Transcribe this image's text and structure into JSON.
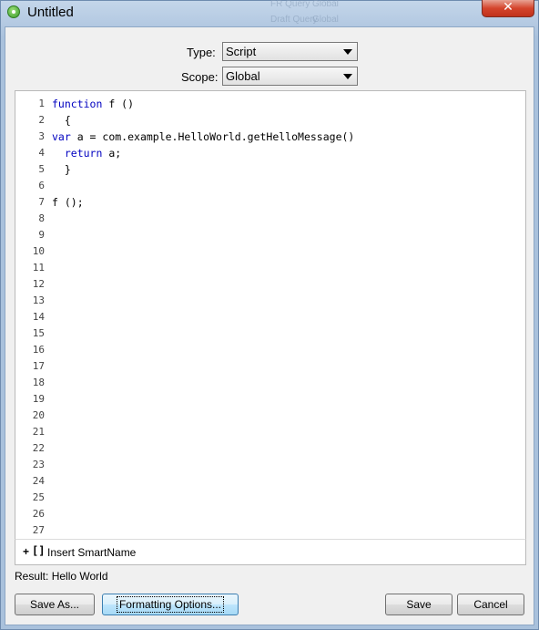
{
  "window": {
    "title": "Untitled",
    "close_glyph": "✕",
    "ghost_text": [
      "FR Query",
      "Global",
      "Draft Query",
      "Global"
    ]
  },
  "form": {
    "type_label": "Type:",
    "type_value": "Script",
    "scope_label": "Scope:",
    "scope_value": "Global"
  },
  "editor": {
    "line_numbers": [
      "1",
      "2",
      "3",
      "4",
      "5",
      "6",
      "7",
      "8",
      "9",
      "10",
      "11",
      "12",
      "13",
      "14",
      "15",
      "16",
      "17",
      "18",
      "19",
      "20",
      "21",
      "22",
      "23",
      "24",
      "25",
      "26",
      "27"
    ],
    "lines": [
      [
        {
          "t": "function",
          "k": true
        },
        {
          "t": " f ()",
          "k": false
        }
      ],
      [
        {
          "t": "  {",
          "k": false
        }
      ],
      [
        {
          "t": "var",
          "k": true
        },
        {
          "t": " a = com.example.HelloWorld.getHelloMessage()",
          "k": false
        }
      ],
      [
        {
          "t": "  ",
          "k": false
        },
        {
          "t": "return",
          "k": true
        },
        {
          "t": " a;",
          "k": false
        }
      ],
      [
        {
          "t": "  }",
          "k": false
        }
      ],
      [],
      [
        {
          "t": "f ();",
          "k": false
        }
      ]
    ]
  },
  "smartname": {
    "plus": "+",
    "brackets": "[]",
    "label": "Insert SmartName"
  },
  "result": {
    "label": "Result:",
    "value": "Hello World"
  },
  "buttons": {
    "save_as": "Save As...",
    "formatting": "Formatting Options...",
    "save": "Save",
    "cancel": "Cancel"
  },
  "colors": {
    "keyword": "#0000c0",
    "close": "#c0321b",
    "focus_button": "#bee6fd"
  },
  "icons": {
    "title": "app-gear-icon",
    "close": "close-icon",
    "dropdown": "chevron-down-icon"
  }
}
